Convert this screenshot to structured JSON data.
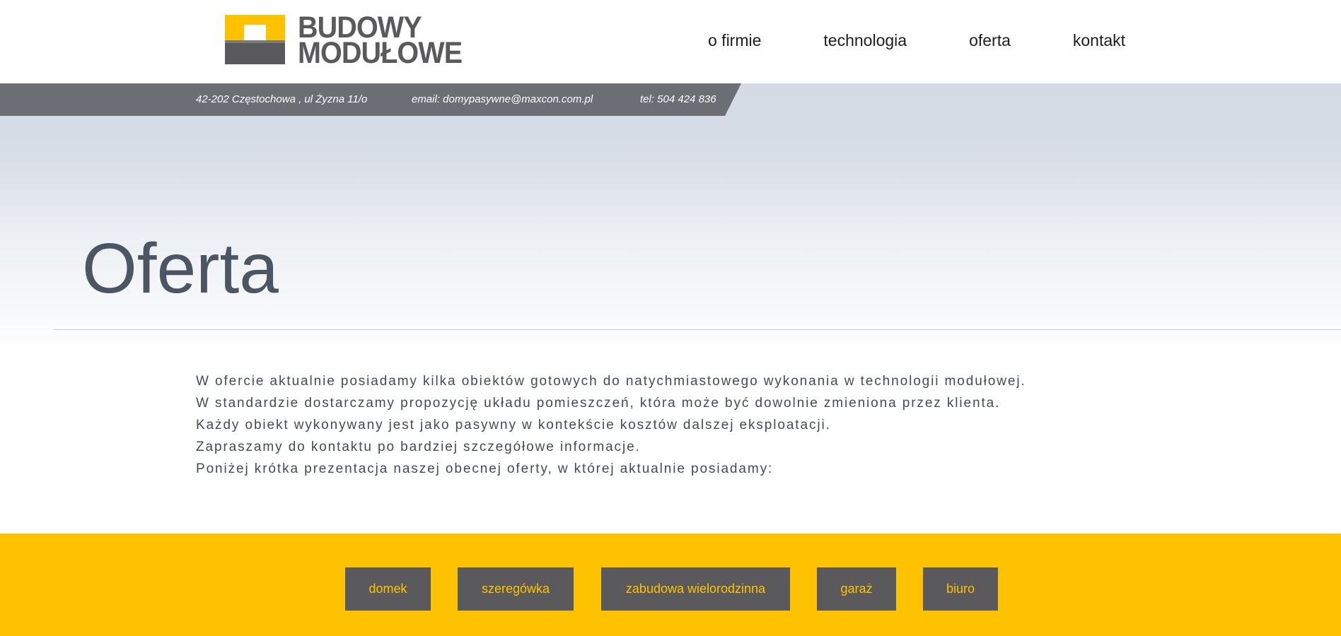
{
  "logo": {
    "line1": "BUDOWY",
    "line2": "MODUŁOWE"
  },
  "nav": {
    "items": [
      {
        "label": "o firmie"
      },
      {
        "label": "technologia"
      },
      {
        "label": "oferta"
      },
      {
        "label": "kontakt"
      }
    ]
  },
  "infobar": {
    "address": "42-202 Częstochowa , ul Żyzna 11/o",
    "email": "email: domypasywne@maxcon.com.pl",
    "phone": "tel: 504 424 836"
  },
  "page": {
    "title": "Oferta",
    "paragraphs": [
      "W ofercie aktualnie posiadamy kilka obiektów gotowych do natychmiastowego wykonania w technologii modułowej.",
      "W standardzie dostarczamy propozycję układu pomieszczeń, która może być dowolnie zmieniona przez klienta.",
      "Każdy obiekt wykonywany jest jako pasywny w kontekście kosztów dalszej eksploatacji.",
      "Zapraszamy do kontaktu po bardziej szczegółowe informacje.",
      "Poniżej krótka prezentacja naszej obecnej oferty, w której aktualnie posiadamy:"
    ]
  },
  "filters": [
    {
      "label": "domek"
    },
    {
      "label": "szeregówka"
    },
    {
      "label": "zabudowa wielorodzinna"
    },
    {
      "label": "garaż"
    },
    {
      "label": "biuro"
    }
  ],
  "colors": {
    "accent_yellow": "#ffc200",
    "dark_gray": "#5a5a5c",
    "infobar_gray": "#6b6e74",
    "text": "#444b55"
  }
}
